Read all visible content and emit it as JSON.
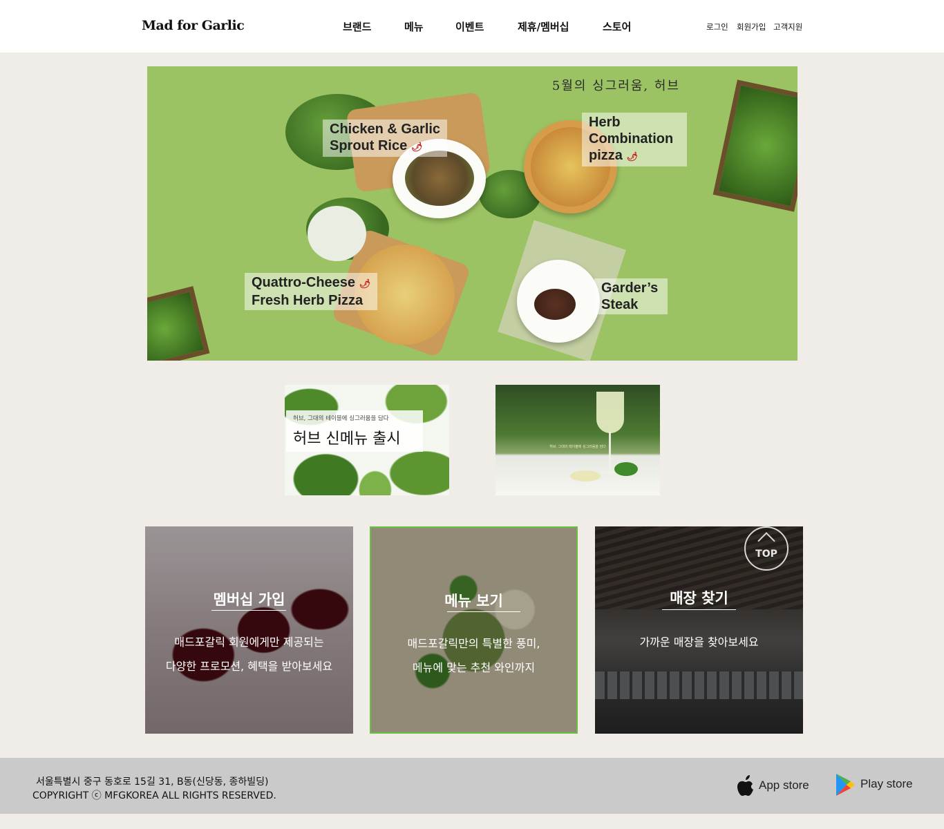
{
  "header": {
    "logo": "Mad for Garlic",
    "nav": [
      "브랜드",
      "메뉴",
      "이벤트",
      "제휴/멤버십",
      "스토어"
    ],
    "util": [
      "로그인",
      "회원가입",
      "고객지원"
    ]
  },
  "hero": {
    "headline": "5월의 싱그러움, 허브",
    "dishes": [
      {
        "line1": "Chicken & Garlic",
        "line2": "Sprout Rice",
        "spicy": true
      },
      {
        "line1": "Herb",
        "line2": "Combination",
        "line3": "pizza",
        "spicy": true
      },
      {
        "line1": "Quattro-Cheese",
        "line2": "Fresh Herb Pizza",
        "spicy": true
      },
      {
        "line1": "Garder’s",
        "line2": "Steak",
        "spicy": false
      }
    ],
    "chili_icon": "🌶"
  },
  "promos": {
    "herb": {
      "small": "허브, 그대의 테이블에 싱그러움을 담다",
      "big": "허브 신메뉴 출시"
    },
    "drink": {
      "caption": "허브, 그대의 테이블에 싱그러움을 담다"
    }
  },
  "cards": [
    {
      "title": "멤버십 가입",
      "lines": [
        "매드포갈릭 회원에게만 제공되는",
        "다양한 프로모션, 혜택을 받아보세요"
      ]
    },
    {
      "title": "메뉴 보기",
      "lines": [
        "매드포갈릭만의 특별한 풍미,",
        "메뉴에 맞는 추천 와인까지"
      ]
    },
    {
      "title": "매장 찾기",
      "lines": [
        "가까운 매장을 찾아보세요"
      ]
    }
  ],
  "top_button": "TOP",
  "footer": {
    "address": "서울특별시 중구 동호로 15길 31, B동(신당동, 종하빌딩)",
    "copyright": "COPYRIGHT ⓒ MFGKOREA ALL RIGHTS RESERVED.",
    "app_store": "App store",
    "play_store": "Play store"
  },
  "icons": {
    "apple": "apple-icon",
    "play": "play-store-icon",
    "top": "chevron-up-icon"
  }
}
